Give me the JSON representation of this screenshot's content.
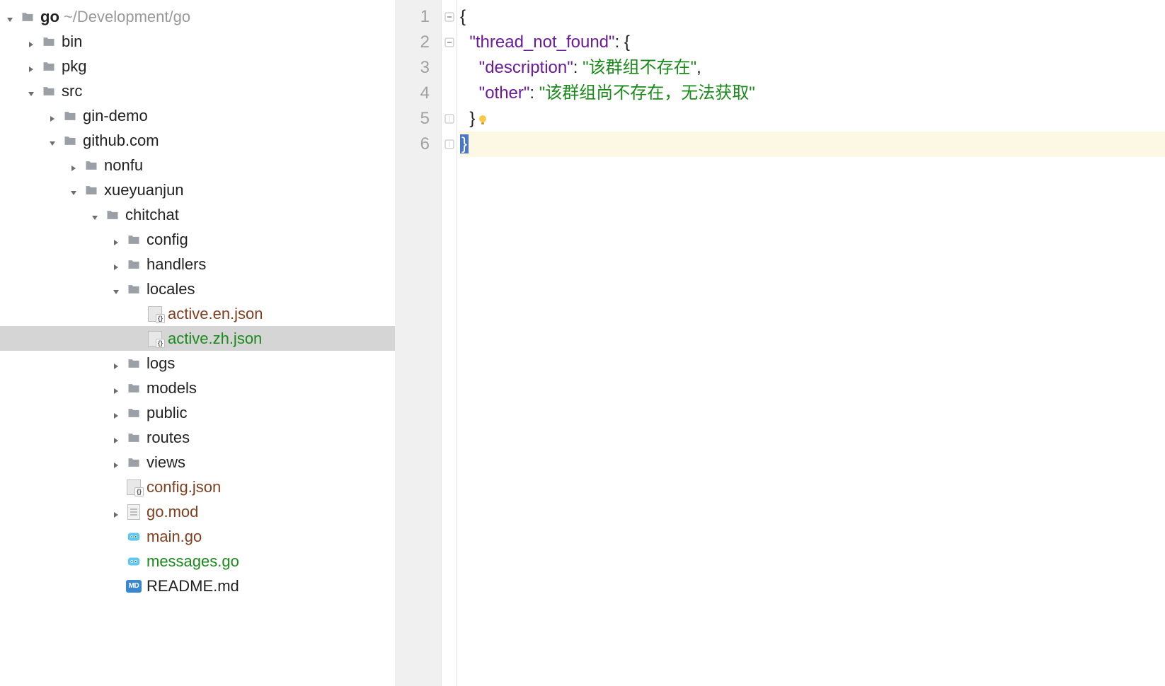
{
  "tree": {
    "root": {
      "name": "go",
      "path": "~/Development/go"
    },
    "bin": "bin",
    "pkg": "pkg",
    "src": "src",
    "gin_demo": "gin-demo",
    "github": "github.com",
    "nonfu": "nonfu",
    "xueyuanjun": "xueyuanjun",
    "chitchat": "chitchat",
    "config": "config",
    "handlers": "handlers",
    "locales": "locales",
    "active_en": "active.en.json",
    "active_zh": "active.zh.json",
    "logs": "logs",
    "models": "models",
    "public": "public",
    "routes": "routes",
    "views": "views",
    "config_json": "config.json",
    "go_mod": "go.mod",
    "main_go": "main.go",
    "messages_go": "messages.go",
    "readme": "README.md"
  },
  "editor": {
    "line_numbers": [
      "1",
      "2",
      "3",
      "4",
      "5",
      "6"
    ],
    "code": {
      "l1_open": "{",
      "l2_key": "\"thread_not_found\"",
      "l2_after": ": {",
      "l3_key": "\"description\"",
      "l3_sep": ": ",
      "l3_val": "\"该群组不存在\"",
      "l3_comma": ",",
      "l4_key": "\"other\"",
      "l4_sep": ": ",
      "l4_val": "\"该群组尚不存在，无法获取\"",
      "l5_close": "}",
      "l6_close": "}"
    }
  }
}
